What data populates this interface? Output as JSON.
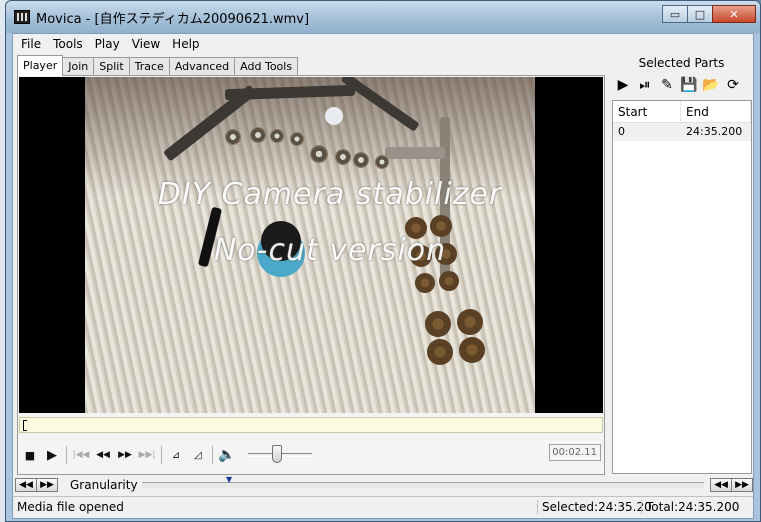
{
  "window": {
    "title": "Movica - [自作ステディカム20090621.wmv]",
    "minimize_glyph": "▭",
    "maximize_glyph": "□",
    "close_glyph": "✕"
  },
  "menu": [
    "File",
    "Tools",
    "Play",
    "View",
    "Help"
  ],
  "tabs": [
    "Player",
    "Join",
    "Split",
    "Trace",
    "Advanced",
    "Add Tools"
  ],
  "video": {
    "caption_line1": "DIY Camera stabilizer",
    "caption_line2": "No-cut version"
  },
  "player": {
    "time": "00:02.11",
    "volume_level": 0.45
  },
  "side_panel": {
    "title": "Selected Parts",
    "columns": [
      "Start",
      "End"
    ],
    "rows": [
      {
        "start": "0",
        "end": "24:35.200"
      }
    ]
  },
  "granularity": {
    "label": "Granularity"
  },
  "status": {
    "message": "Media file opened",
    "selected": "Selected:24:35.20",
    "total": "Total:24:35.200"
  },
  "colors": {
    "title_bar": "#a7c2da",
    "seek_bar": "#fbfbe0",
    "close_button": "#c7472b"
  }
}
